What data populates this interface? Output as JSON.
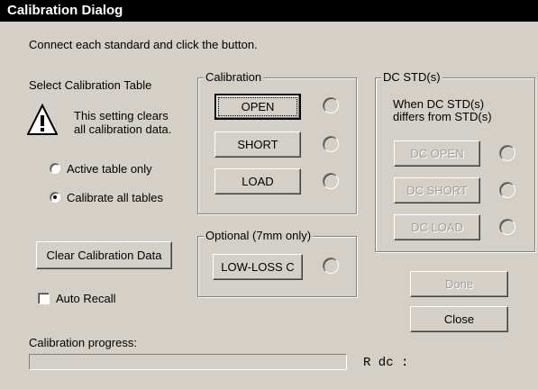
{
  "window": {
    "title": "Calibration Dialog"
  },
  "instruction": "Connect each standard and click the button.",
  "left": {
    "table_heading": "Select Calibration Table",
    "warning_icon": "warning-icon",
    "warning_line1": "This setting clears",
    "warning_line2": "all calibration data.",
    "options": [
      {
        "label": "Active table only",
        "selected": false
      },
      {
        "label": "Calibrate all tables",
        "selected": true
      }
    ],
    "clear_button": "Clear Calibration Data",
    "auto_recall_label": "Auto Recall",
    "auto_recall_checked": false
  },
  "calibration": {
    "legend": "Calibration",
    "buttons": [
      "OPEN",
      "SHORT",
      "LOAD"
    ]
  },
  "optional": {
    "legend": "Optional (7mm only)",
    "button": "LOW-LOSS C"
  },
  "dc": {
    "legend": "DC STD(s)",
    "note_line1": "When DC STD(s)",
    "note_line2": "differs from STD(s)",
    "buttons": [
      "DC OPEN",
      "DC SHORT",
      "DC LOAD"
    ]
  },
  "actions": {
    "done": "Done",
    "close": "Close"
  },
  "progress": {
    "label": "Calibration progress:",
    "value": 0
  },
  "rdc_label": "R dc :"
}
